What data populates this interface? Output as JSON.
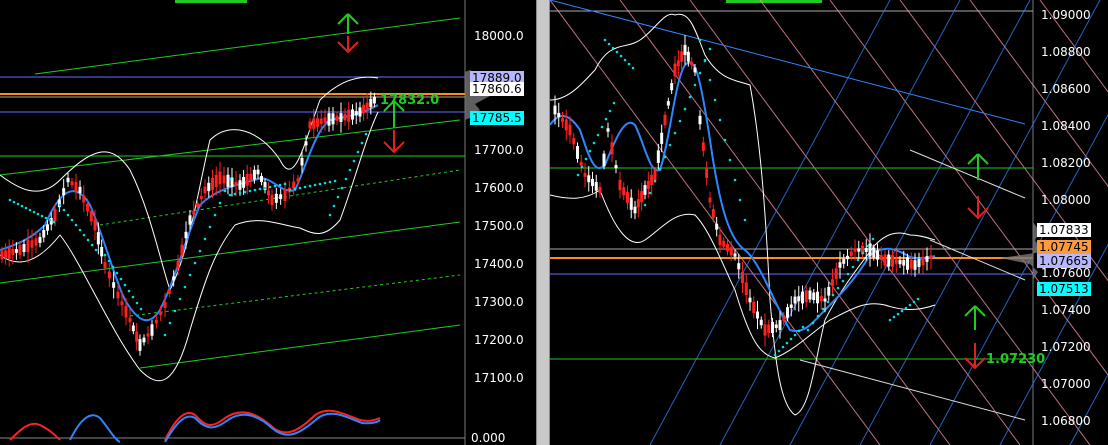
{
  "left_chart": {
    "y_axis_labels": [
      "18000.0",
      "17700.0",
      "17600.0",
      "17500.0",
      "17400.0",
      "17300.0",
      "17200.0",
      "17100.0"
    ],
    "y_axis_values": [
      18000,
      17700,
      17600,
      17500,
      17400,
      17300,
      17200,
      17100
    ],
    "indicator_axis_label": "0.000",
    "price_tags": [
      {
        "label": "17889.0",
        "value": 17889,
        "bg": "#b7b7ff",
        "fg": "#000000"
      },
      {
        "label": "17860.6",
        "value": 17860.6,
        "bg": "#ffffff",
        "fg": "#000000"
      },
      {
        "label": "17785.5",
        "value": 17785.5,
        "bg": "#00ffff",
        "fg": "#000000"
      }
    ],
    "target_label": "17832.0",
    "up_arrow_color": "#22c922",
    "down_arrow_color": "#e02020"
  },
  "right_chart": {
    "y_axis_labels": [
      "1.09000",
      "1.08800",
      "1.08600",
      "1.08400",
      "1.08200",
      "1.08000",
      "1.07600",
      "1.07400",
      "1.07200",
      "1.07000",
      "1.06800"
    ],
    "y_axis_values": [
      1.09,
      1.088,
      1.086,
      1.084,
      1.082,
      1.08,
      1.076,
      1.074,
      1.072,
      1.07,
      1.068
    ],
    "price_tags": [
      {
        "label": "1.07833",
        "value": 1.07833,
        "bg": "#ffffff",
        "fg": "#000000"
      },
      {
        "label": "1.07745",
        "value": 1.07745,
        "bg": "#ff9a3c",
        "fg": "#000000"
      },
      {
        "label": "1.07665",
        "value": 1.07665,
        "bg": "#b7b7ff",
        "fg": "#000000"
      },
      {
        "label": "1.07513",
        "value": 1.07513,
        "bg": "#00ffff",
        "fg": "#000000"
      }
    ],
    "target_label": "1.07230",
    "up_arrow_color": "#22c922",
    "down_arrow_color": "#e02020"
  },
  "colors": {
    "background": "#000000",
    "bull_candle": "#ffffff",
    "bear_candle": "#ff2020",
    "moving_average": "#2e86ff",
    "bollinger": "#ffffff",
    "parabolic_sar": "#00e0e0",
    "trend_line": "#22c922",
    "support_line": "#ff8c1a",
    "channel_line": "#6d6dff"
  }
}
